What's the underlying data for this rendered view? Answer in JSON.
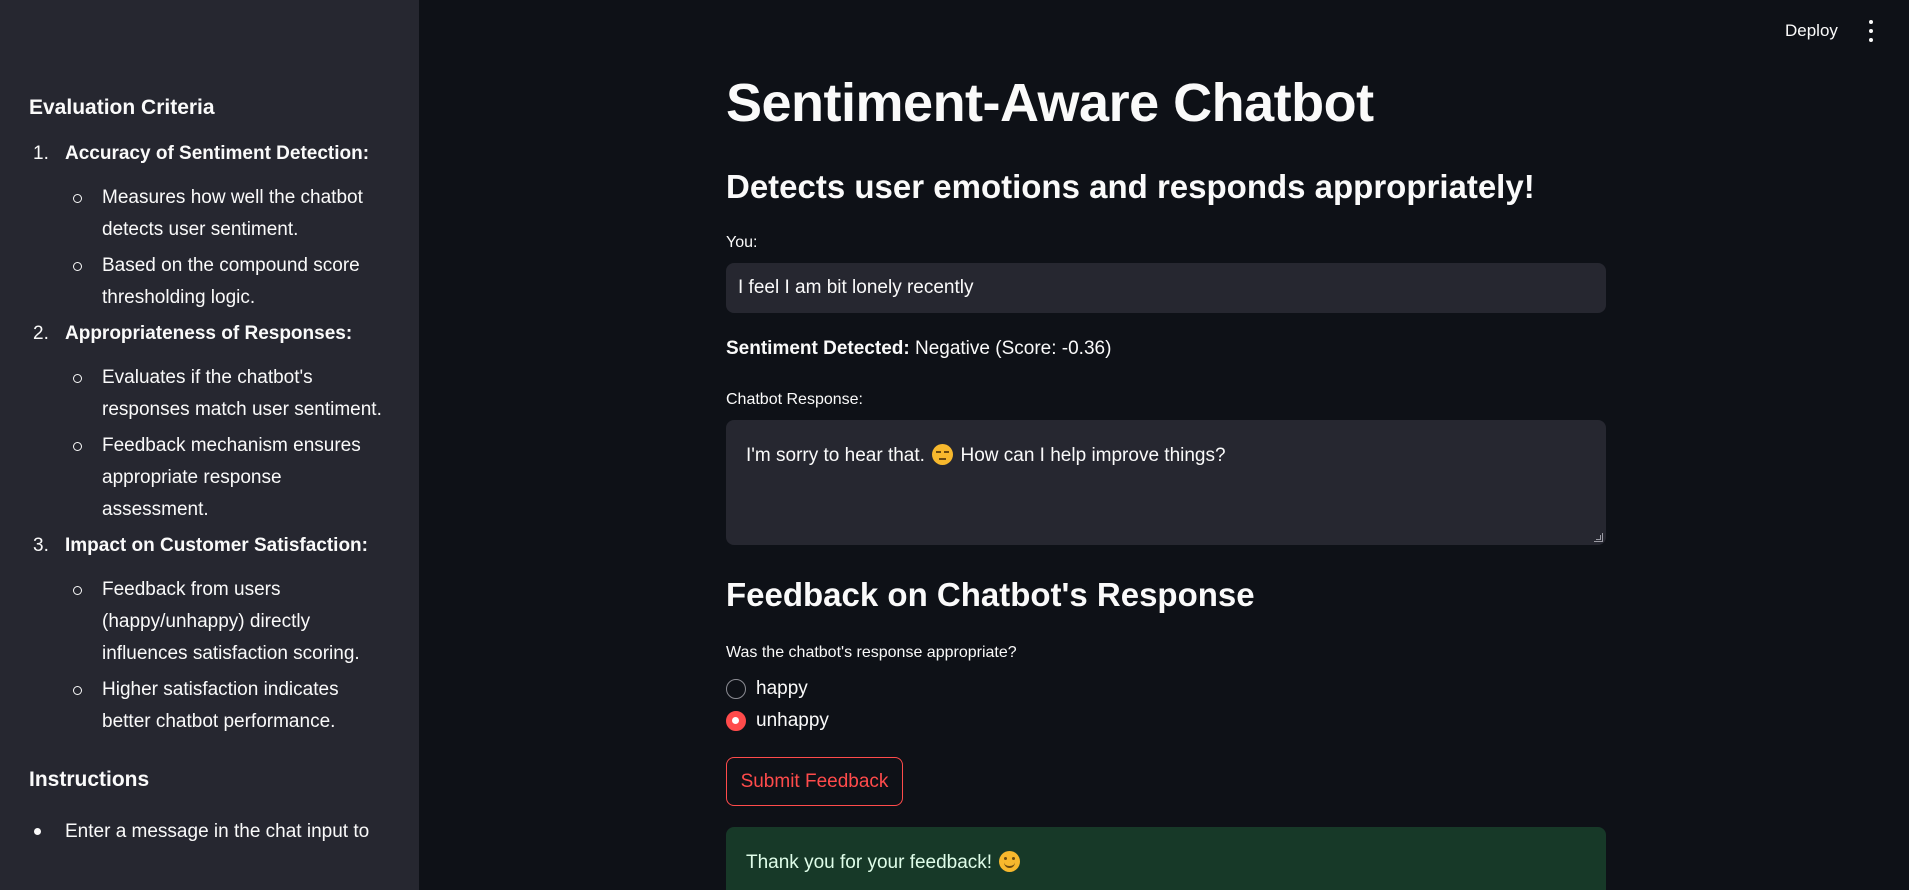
{
  "header": {
    "deploy_label": "Deploy",
    "menu_icon": "more-vertical-icon"
  },
  "sidebar": {
    "criteria_heading": "Evaluation Criteria",
    "criteria": [
      {
        "number": "1.",
        "title": "Accuracy of Sentiment Detection:",
        "points": [
          "Measures how well the chatbot detects user sentiment.",
          "Based on the compound score thresholding logic."
        ]
      },
      {
        "number": "2.",
        "title": "Appropriateness of Responses:",
        "points": [
          "Evaluates if the chatbot's responses match user sentiment.",
          "Feedback mechanism ensures appropriate response assessment."
        ]
      },
      {
        "number": "3.",
        "title": "Impact on Customer Satisfaction:",
        "points": [
          "Feedback from users (happy/unhappy) directly influences satisfaction scoring.",
          "Higher satisfaction indicates better chatbot performance."
        ]
      }
    ],
    "instructions_heading": "Instructions",
    "instructions": [
      "Enter a message in the chat input to"
    ]
  },
  "main": {
    "title": "Sentiment-Aware Chatbot",
    "subtitle": "Detects user emotions and responds appropriately!",
    "you_label": "You:",
    "you_value": "I feel I am bit lonely recently",
    "sentiment_label": "Sentiment Detected:",
    "sentiment_value": "Negative (Score: -0.36)",
    "response_label": "Chatbot Response:",
    "response_before": "I'm sorry to hear that.",
    "response_emoji": "pensive-face-icon",
    "response_after": "How can I help improve things?",
    "feedback_heading": "Feedback on Chatbot's Response",
    "feedback_question": "Was the chatbot's response appropriate?",
    "options": [
      {
        "label": "happy",
        "selected": false
      },
      {
        "label": "unhappy",
        "selected": true
      }
    ],
    "submit_label": "Submit Feedback",
    "success_text": "Thank you for your feedback!",
    "success_emoji": "smiling-face-icon"
  },
  "colors": {
    "background": "#0e1117",
    "sidebar": "#262730",
    "accent": "#ff4b4b",
    "success_bg": "#173928",
    "success_text": "#dffde9"
  }
}
